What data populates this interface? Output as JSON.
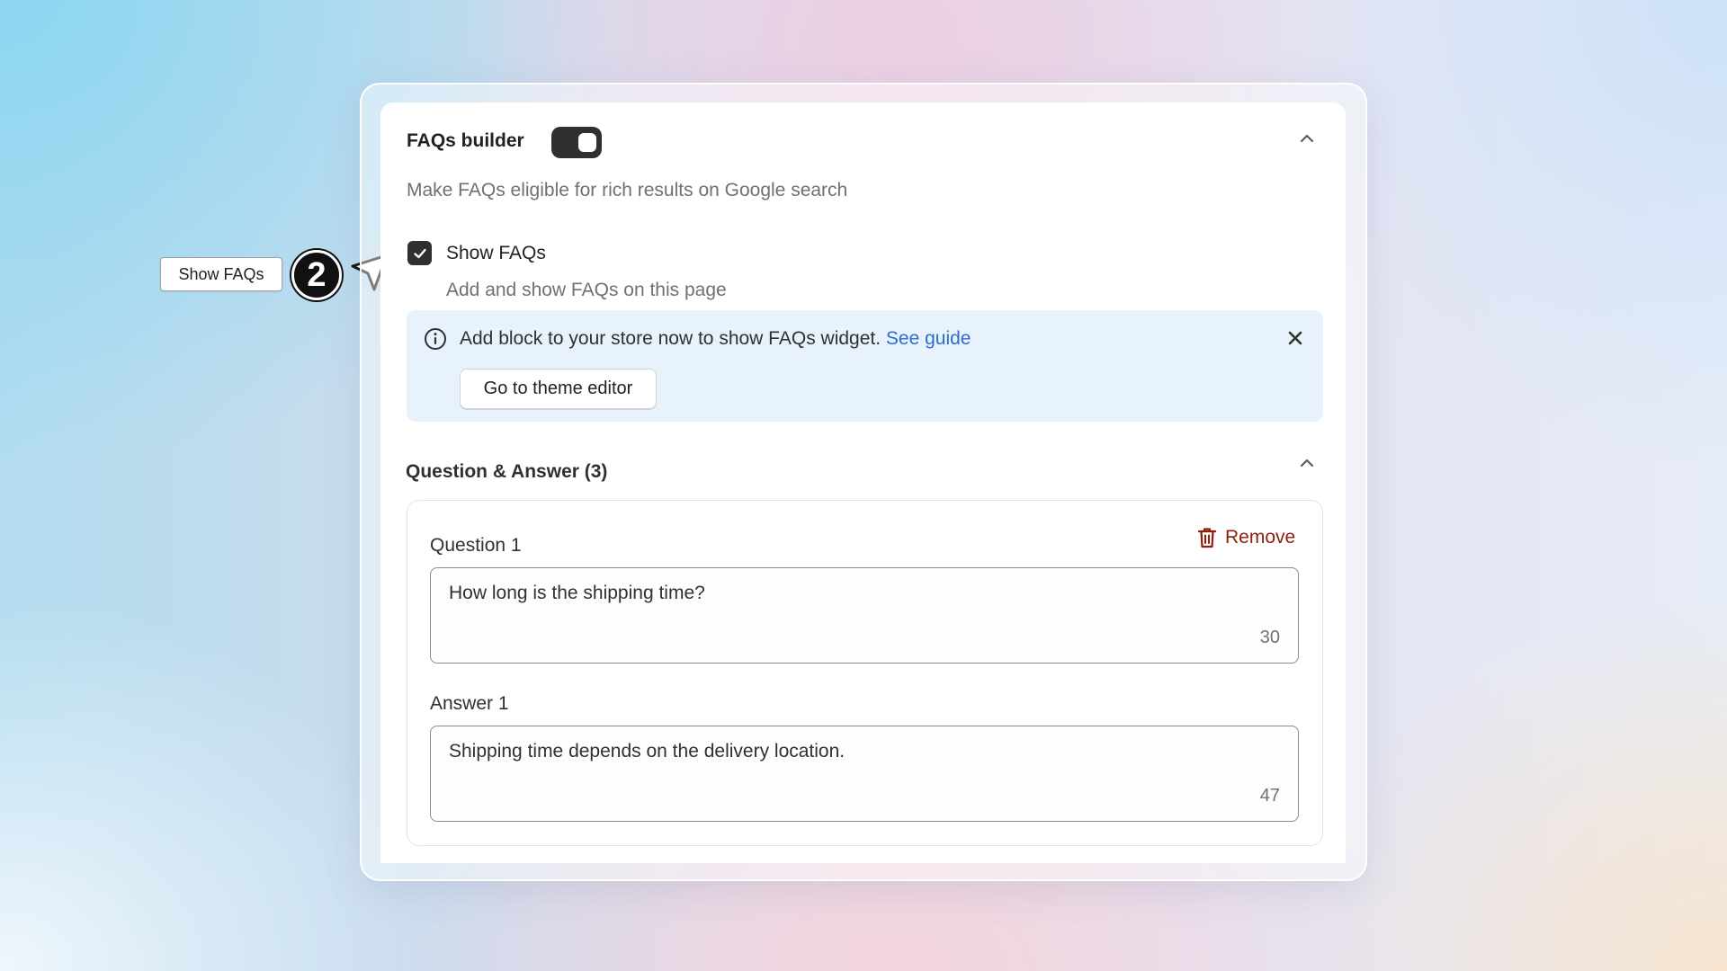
{
  "annotation": {
    "label": "Show FAQs",
    "step_number": "2"
  },
  "header": {
    "title": "FAQs builder",
    "toggle_on": true,
    "description": "Make FAQs eligible for rich results on Google search"
  },
  "show_faqs": {
    "checked": true,
    "label": "Show FAQs",
    "help": "Add and show FAQs on this page"
  },
  "banner": {
    "message": "Add block to your store now to show FAQs widget.",
    "link_text": "See guide",
    "button_label": "Go to theme editor",
    "background": "#e8f2fd",
    "link_color": "#2c6ecb"
  },
  "qa_section": {
    "title": "Question & Answer (3)",
    "items": [
      {
        "remove_label": "Remove",
        "question_label": "Question 1",
        "question_value": "How long is the shipping time?",
        "question_count": "30",
        "answer_label": "Answer 1",
        "answer_value": "Shipping time depends on the delivery location.",
        "answer_count": "47"
      }
    ]
  },
  "icons": {
    "collapse": "chevron-up-icon",
    "info": "info-icon",
    "close": "close-icon",
    "remove": "trash-icon",
    "cursor": "cursor-arrow-icon",
    "check": "checkmark-icon"
  },
  "colors": {
    "toggle": "#303030",
    "remove": "#8e1f0b"
  }
}
